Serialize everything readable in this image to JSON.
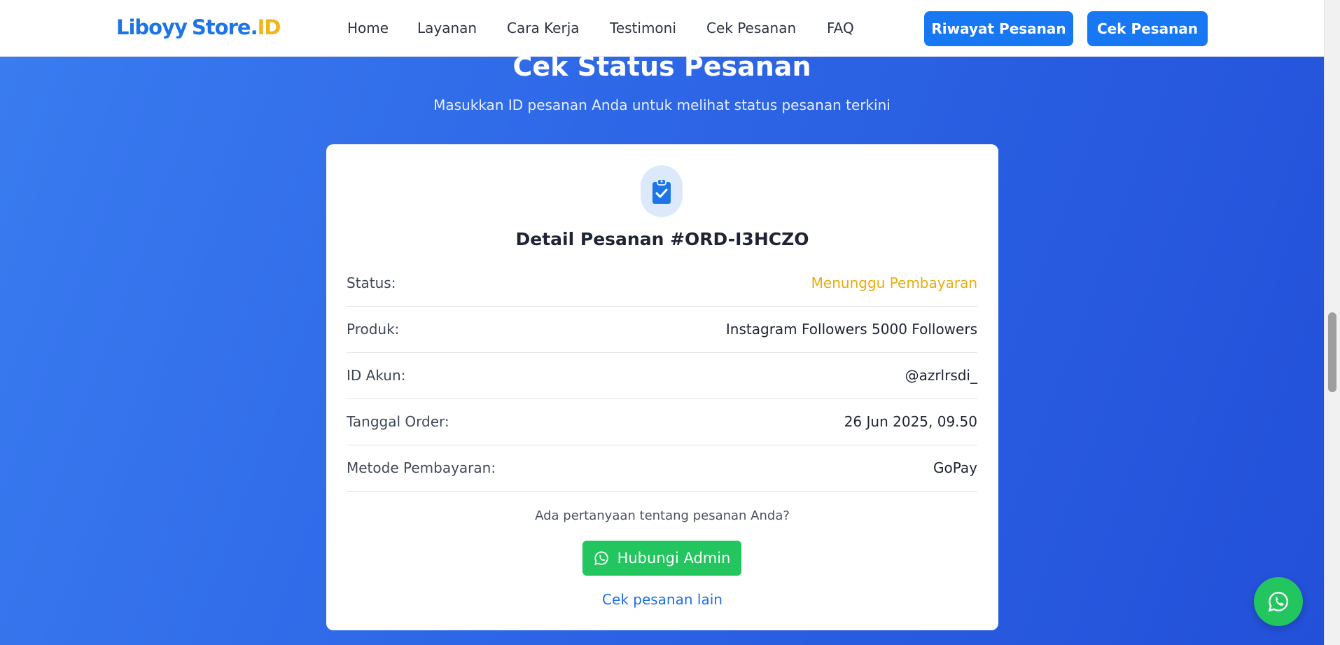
{
  "logo": {
    "part1": "Liboyy",
    "part2": "Store.",
    "part3": "ID"
  },
  "nav": {
    "links": [
      "Home",
      "Layanan",
      "Cara Kerja",
      "Testimoni",
      "Cek Pesanan",
      "FAQ"
    ],
    "buttons": {
      "history": "Riwayat Pesanan",
      "check": "Cek Pesanan"
    }
  },
  "hero": {
    "title": "Cek Status Pesanan",
    "subtitle": "Masukkan ID pesanan Anda untuk melihat status pesanan terkini"
  },
  "order": {
    "title": "Detail Pesanan #ORD-I3HCZO",
    "rows": [
      {
        "label": "Status:",
        "value": "Menunggu Pembayaran"
      },
      {
        "label": "Produk:",
        "value": "Instagram Followers 5000 Followers"
      },
      {
        "label": "ID Akun:",
        "value": "@azrlrsdi_"
      },
      {
        "label": "Tanggal Order:",
        "value": "26 Jun 2025, 09.50"
      },
      {
        "label": "Metode Pembayaran:",
        "value": "GoPay"
      }
    ],
    "question": "Ada pertanyaan tentang pesanan Anda?",
    "contact_button": "Hubungi Admin",
    "other_link": "Cek pesanan lain"
  },
  "colors": {
    "primary": "#1877f2",
    "status_pending": "#e8ac11",
    "whatsapp": "#22c55e",
    "logo_accent": "#f2b418"
  },
  "icons": {
    "order": "clipboard-check-icon",
    "contact": "whatsapp-icon",
    "floating": "whatsapp-icon"
  }
}
